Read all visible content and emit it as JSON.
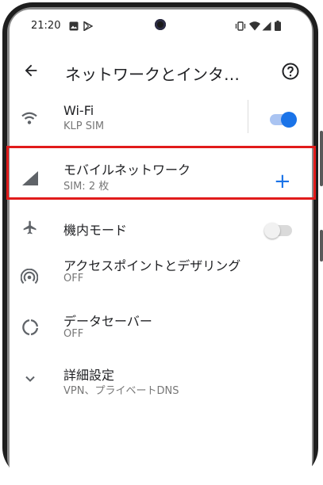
{
  "status_bar": {
    "time": "21:20",
    "icons": [
      "image-icon",
      "play-store-icon",
      "vibrate-icon",
      "wifi-icon",
      "signal-icon",
      "battery-icon"
    ]
  },
  "app_bar": {
    "title": "ネットワークとインタ…",
    "back_icon": "arrow-back-icon",
    "help_icon": "help-icon"
  },
  "settings": [
    {
      "id": "wifi",
      "title": "Wi-Fi",
      "subtitle": "KLP SIM",
      "icon": "wifi-icon",
      "control": "toggle",
      "toggle_on": true
    },
    {
      "id": "mobile-network",
      "title": "モバイルネットワーク",
      "subtitle": "SIM: 2 枚",
      "icon": "cell-signal-icon",
      "control": "add",
      "add_symbol": "+",
      "highlighted": true
    },
    {
      "id": "airplane-mode",
      "title": "機内モード",
      "subtitle": "",
      "icon": "airplane-icon",
      "control": "toggle",
      "toggle_on": false
    },
    {
      "id": "hotspot-tethering",
      "title": "アクセスポイントとデザリング",
      "subtitle": "OFF",
      "icon": "hotspot-icon",
      "control": "none"
    },
    {
      "id": "data-saver",
      "title": "データセーバー",
      "subtitle": "OFF",
      "icon": "data-saver-icon",
      "control": "none"
    },
    {
      "id": "advanced",
      "title": "詳細設定",
      "subtitle": "VPN、プライベートDNS",
      "icon": "chevron-down-icon",
      "control": "none"
    }
  ],
  "colors": {
    "accent": "#1a73e8",
    "highlight_border": "#e11b1b",
    "icon_gray": "#5f6368"
  }
}
